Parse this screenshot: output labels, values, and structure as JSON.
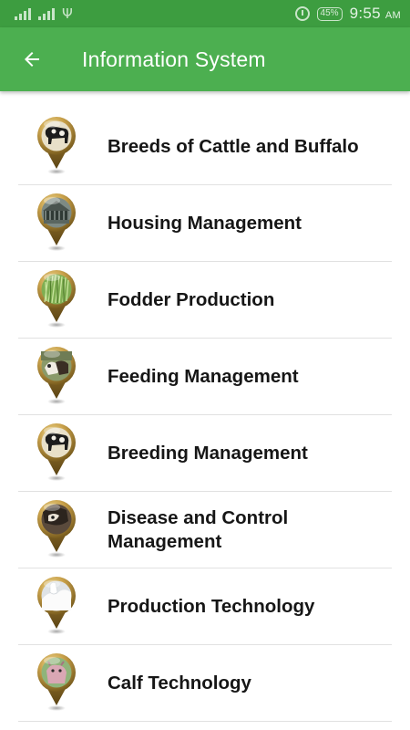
{
  "status_bar": {
    "battery": "45%",
    "time": "9:55",
    "ampm": "AM",
    "icons": [
      "signal-icon",
      "signal-icon",
      "usb-icon",
      "alarm-icon",
      "battery-icon"
    ]
  },
  "app_bar": {
    "title": "Information System",
    "back_icon": "arrow-left-icon",
    "color": "#4caf50"
  },
  "menu": {
    "items": [
      {
        "label": "Breeds of Cattle and Buffalo",
        "icon": "cattle-pin-icon"
      },
      {
        "label": "Housing Management",
        "icon": "shed-pin-icon"
      },
      {
        "label": "Fodder Production",
        "icon": "grass-pin-icon"
      },
      {
        "label": "Feeding Management",
        "icon": "feeding-pin-icon"
      },
      {
        "label": "Breeding Management",
        "icon": "cow-pin-icon"
      },
      {
        "label": "Disease and Control Management",
        "icon": "disease-pin-icon"
      },
      {
        "label": "Production Technology",
        "icon": "milk-pin-icon"
      },
      {
        "label": "Calf Technology",
        "icon": "calf-pin-icon"
      }
    ]
  }
}
